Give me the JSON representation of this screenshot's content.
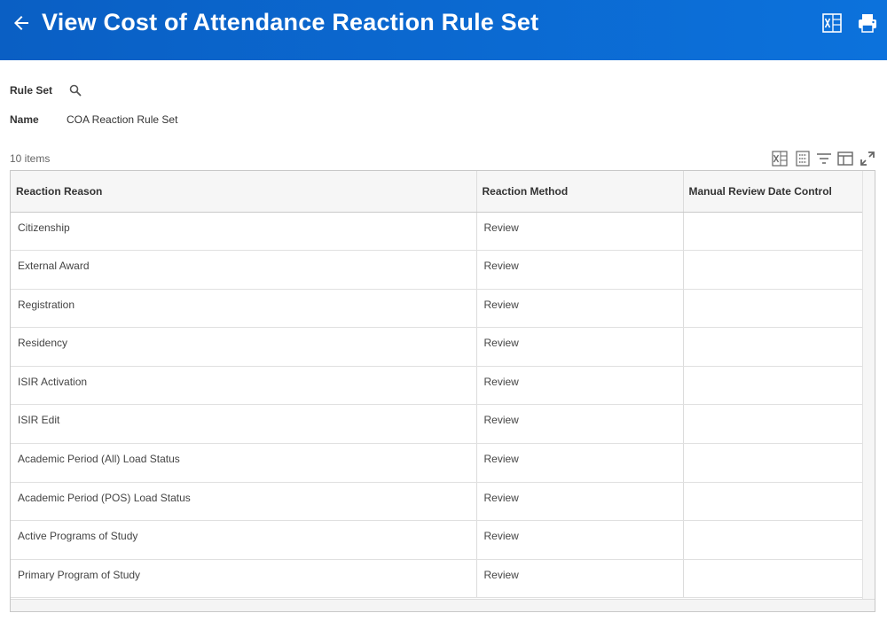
{
  "header": {
    "title": "View Cost of Attendance Reaction Rule Set",
    "back_icon": "arrow-left-icon",
    "excel_icon": "excel-export-icon",
    "print_icon": "printer-icon",
    "colors": {
      "header_start": "#0a5fc4",
      "header_end": "#0c72dc"
    }
  },
  "fields": {
    "rule_set_label": "Rule Set",
    "name_label": "Name",
    "name_value": "COA Reaction Rule Set"
  },
  "grid": {
    "count": "10 items",
    "columns": [
      "Reaction Reason",
      "Reaction Method",
      "Manual Review Date Control"
    ],
    "rows": [
      [
        "Citizenship",
        "Review",
        ""
      ],
      [
        "External Award",
        "Review",
        ""
      ],
      [
        "Registration",
        "Review",
        ""
      ],
      [
        "Residency",
        "Review",
        ""
      ],
      [
        "ISIR Activation",
        "Review",
        ""
      ],
      [
        "ISIR Edit",
        "Review",
        ""
      ],
      [
        "Academic Period (All) Load Status",
        "Review",
        ""
      ],
      [
        "Academic Period (POS) Load Status",
        "Review",
        ""
      ],
      [
        "Active Programs of Study",
        "Review",
        ""
      ],
      [
        "Primary Program of Study",
        "Review",
        ""
      ]
    ]
  }
}
